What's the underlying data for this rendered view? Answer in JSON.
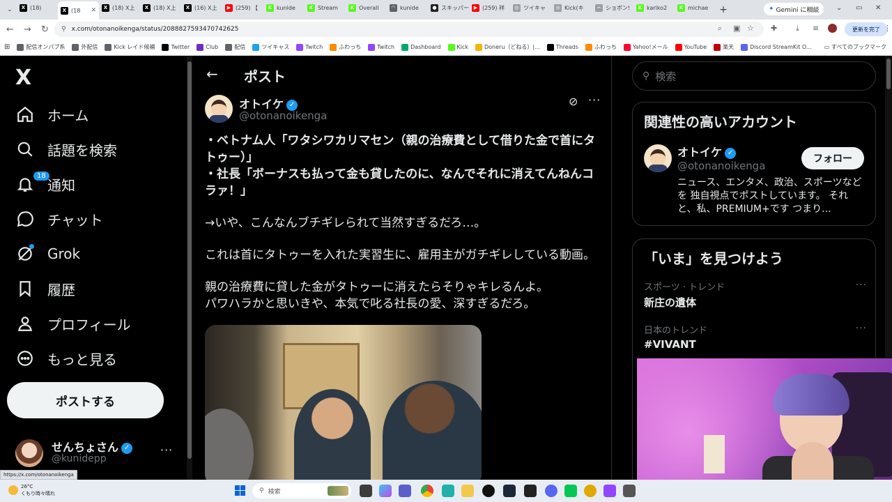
{
  "browser": {
    "tabs": [
      {
        "label": "(18)",
        "color": "#000000",
        "glyph": "X",
        "active": false
      },
      {
        "label": "(18",
        "color": "#000000",
        "glyph": "X",
        "active": true
      },
      {
        "label": "(18) X上",
        "color": "#000000",
        "glyph": "X",
        "active": false
      },
      {
        "label": "(18) X上",
        "color": "#000000",
        "glyph": "X",
        "active": false
      },
      {
        "label": "(16) X上",
        "color": "#000000",
        "glyph": "X",
        "active": false
      },
      {
        "label": "(259) 【",
        "color": "#ff0000",
        "glyph": "▶",
        "active": false
      },
      {
        "label": "kunide",
        "color": "#53fc18",
        "glyph": "K",
        "active": false
      },
      {
        "label": "Stream",
        "color": "#53fc18",
        "glyph": "K",
        "active": false
      },
      {
        "label": "Overall",
        "color": "#53fc18",
        "glyph": "K",
        "active": false
      },
      {
        "label": "kunide",
        "color": "#5f6368",
        "glyph": "◠",
        "active": false
      },
      {
        "label": "スキッパー",
        "color": "#222222",
        "glyph": "●",
        "active": false
      },
      {
        "label": "(259) 祥",
        "color": "#ff0000",
        "glyph": "▶",
        "active": false
      },
      {
        "label": "ツイキャ",
        "color": "#9aa0a6",
        "glyph": "◎",
        "active": false
      },
      {
        "label": "Kick(キ",
        "color": "#9aa0a6",
        "glyph": "◎",
        "active": false
      },
      {
        "label": "ショボン!",
        "color": "#9aa0a6",
        "glyph": "∽",
        "active": false
      },
      {
        "label": "kariko2",
        "color": "#53fc18",
        "glyph": "K",
        "active": false
      },
      {
        "label": "michae",
        "color": "#53fc18",
        "glyph": "K",
        "active": false
      }
    ],
    "gemini_label": "Gemini に相談",
    "address": "x.com/otonanoikenga/status/2088827593470742625",
    "update_label": "更新を完了",
    "bookmarks": [
      {
        "label": "配信オンパブ系",
        "color": "#5f6368"
      },
      {
        "label": "外配信",
        "color": "#5f6368"
      },
      {
        "label": "Kick レイド候補",
        "color": "#5f6368"
      },
      {
        "label": "Twitter",
        "color": "#000000"
      },
      {
        "label": "Club",
        "color": "#6a2cc7"
      },
      {
        "label": "配信",
        "color": "#5f6368"
      },
      {
        "label": "ツイキャス",
        "color": "#1da1f2"
      },
      {
        "label": "Twitch",
        "color": "#9146ff"
      },
      {
        "label": "ふわっち",
        "color": "#ff8a00"
      },
      {
        "label": "Twitch",
        "color": "#9146ff"
      },
      {
        "label": "Dashboard",
        "color": "#00a86b"
      },
      {
        "label": "Kick",
        "color": "#53fc18"
      },
      {
        "label": "Doneru（どねる）|...",
        "color": "#f4b400"
      },
      {
        "label": "Threads",
        "color": "#000000"
      },
      {
        "label": "ふわっち",
        "color": "#ff8a00"
      },
      {
        "label": "Yahoo!メール",
        "color": "#ff0033"
      },
      {
        "label": "YouTube",
        "color": "#ff0000"
      },
      {
        "label": "楽天",
        "color": "#bf0000"
      },
      {
        "label": "Discord StreamKit O...",
        "color": "#5865f2"
      }
    ],
    "all_bookmarks": "すべてのブックマーク",
    "url_tooltip": "https://x.com/otonanoikenga"
  },
  "nav": {
    "logo": "X",
    "items": [
      {
        "label": "ホーム",
        "icon": "home-icon"
      },
      {
        "label": "話題を検索",
        "icon": "search-icon"
      },
      {
        "label": "通知",
        "icon": "bell-icon",
        "badge": "18"
      },
      {
        "label": "チャット",
        "icon": "chat-icon"
      },
      {
        "label": "Grok",
        "icon": "grok-icon"
      },
      {
        "label": "履歴",
        "icon": "bookmark-icon"
      },
      {
        "label": "プロフィール",
        "icon": "person-icon"
      },
      {
        "label": "もっと見る",
        "icon": "more-circle-icon"
      }
    ],
    "post_button": "ポストする",
    "account": {
      "name": "せんちょさん",
      "handle": "@kunidepp",
      "more": "···"
    }
  },
  "main": {
    "title": "ポスト",
    "post": {
      "name": "オトイケ",
      "handle": "@otonanoikenga",
      "lines_bold": [
        "・ベトナム人「ワタシワカリマセン（親の治療費として借りた金で首にタトゥー）」",
        "・社長「ボーナスも払って金も貸したのに、なんでそれに消えてんねんコラァ！」"
      ],
      "para1": "→いや、こんなんブチギレられて当然すぎるだろ…。",
      "para2": "これは首にタトゥーを入れた実習生に、雇用主がガチギレしている動画。",
      "para3a": "親の治療費に貸した金がタトゥーに消えたらそりゃキレるんよ。",
      "para3b": "パワハラかと思いきや、本気で叱る社長の愛、深すぎるだろ。"
    }
  },
  "right": {
    "search_placeholder": "検索",
    "related": {
      "title": "関連性の高いアカウント",
      "name": "オトイケ",
      "handle": "@otonanoikenga",
      "follow": "フォロー",
      "bio": "ニュース、エンタメ、政治、スポーツなどを 独自視点でポストしています。 それと、私、PREMIUM+です つまり..."
    },
    "discover": {
      "title": "「いま」を見つけよう",
      "trends": [
        {
          "meta": "スポーツ · トレンド",
          "name": "新庄の遺体"
        },
        {
          "meta": "日本のトレンド",
          "name": "#VIVANT"
        }
      ]
    }
  },
  "taskbar": {
    "weather_temp": "26°C",
    "weather_desc": "くもり時々晴れ",
    "search_label": "検索"
  }
}
